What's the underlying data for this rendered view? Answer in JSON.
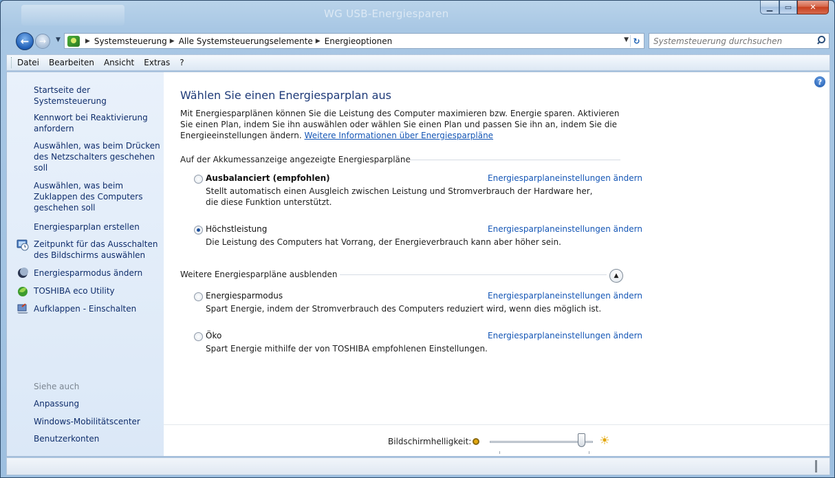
{
  "window": {
    "title": "WG USB-Energiesparen",
    "controls": {
      "minimize": "▁",
      "maximize": "▭",
      "close": "✕"
    }
  },
  "nav": {
    "back_icon": "←",
    "forward_icon": "→",
    "breadcrumb": [
      "Systemsteuerung",
      "Alle Systemsteuerungselemente",
      "Energieoptionen"
    ],
    "search_placeholder": "Systemsteuerung durchsuchen"
  },
  "menu": [
    "Datei",
    "Bearbeiten",
    "Ansicht",
    "Extras",
    "?"
  ],
  "sidebar": {
    "home": "Startseite der Systemsteuerung",
    "links": [
      "Kennwort bei Reaktivierung anfordern",
      "Auswählen, was beim Drücken des Netzschalters geschehen soll",
      "Auswählen, was beim Zuklappen des Computers geschehen soll",
      "Energiesparplan erstellen",
      "Zeitpunkt für das Ausschalten des Bildschirms auswählen",
      "Energiesparmodus ändern",
      "TOSHIBA eco Utility",
      "Aufklappen - Einschalten"
    ],
    "see_also_heading": "Siehe auch",
    "see_also": [
      "Anpassung",
      "Windows-Mobilitätscenter",
      "Benutzerkonten"
    ]
  },
  "main": {
    "title": "Wählen Sie einen Energiesparplan aus",
    "intro": "Mit Energiesparplänen können Sie die Leistung des Computer maximieren bzw. Energie sparen. Aktivieren Sie einen Plan, indem Sie ihn auswählen oder wählen Sie einen Plan und passen Sie ihn an, indem Sie die Energieeinstellungen ändern.",
    "intro_link": "Weitere Informationen über Energiesparpläne",
    "group_main": "Auf der Akkumessanzeige angezeigte Energiesparpläne",
    "group_more": "Weitere Energiesparpläne ausblenden",
    "change_link": "Energiesparplaneinstellungen ändern",
    "plans": [
      {
        "name": "Ausbalanciert (empfohlen)",
        "desc": "Stellt automatisch einen Ausgleich zwischen Leistung und Stromverbrauch der Hardware her, die diese Funktion unterstützt.",
        "selected": false
      },
      {
        "name": "Höchstleistung",
        "desc": "Die Leistung des Computers hat Vorrang, der Energieverbrauch kann aber höher sein.",
        "selected": true
      },
      {
        "name": "Energiesparmodus",
        "desc": "Spart Energie, indem der Stromverbrauch des Computers reduziert wird, wenn dies möglich ist.",
        "selected": false
      },
      {
        "name": "Öko",
        "desc": "Spart Energie mithilfe der von TOSHIBA empfohlenen Einstellungen.",
        "selected": false
      }
    ]
  },
  "brightness": {
    "label": "Bildschirmhelligkeit:",
    "level_fraction": 0.92
  },
  "colors": {
    "link": "#1355b5",
    "title": "#1e3a78",
    "sidebar_link": "#0f2d6b",
    "sidebar_bg": "#dbe8f7"
  }
}
